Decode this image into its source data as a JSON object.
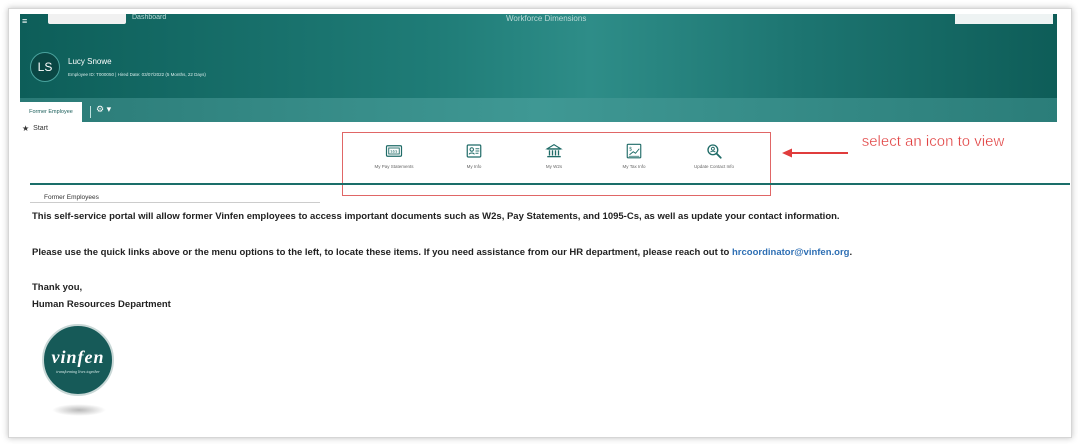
{
  "header": {
    "top_muted_text": "Dashboard",
    "app_title": "Workforce Dimensions",
    "user_initials": "LS",
    "user_name": "Lucy Snowe",
    "user_meta": "Employee ID: T000050  |  Hired Date: 03/07/2022 (5 Months, 22 Days)"
  },
  "tabs": {
    "active_label": "Former Employee",
    "gear_icon": "gear-icon"
  },
  "start_label": "Start",
  "quick_links": [
    {
      "label": "My Pay Statements",
      "icon": "pay-statement-icon"
    },
    {
      "label": "My Info",
      "icon": "id-card-icon"
    },
    {
      "label": "My W2s",
      "icon": "bank-icon"
    },
    {
      "label": "My Tax Info",
      "icon": "tax-document-icon"
    },
    {
      "label": "Update Contact Info",
      "icon": "magnifier-icon"
    }
  ],
  "annotation": {
    "text": "select an icon to view",
    "color": "#e03c3c"
  },
  "content": {
    "section_title": "Former Employees",
    "paragraph1": "This self-service portal will allow former Vinfen employees to access important documents such as W2s, Pay Statements, and 1095-Cs, as well as update your contact information.",
    "paragraph2_prefix": "Please use the quick links above or the menu options to the left, to locate these items. If you need assistance from our HR department, please reach out to ",
    "paragraph2_email": "hrcoordinator@vinfen.org",
    "paragraph2_suffix": ".",
    "closing": "Thank you,",
    "signature": "Human Resources Department"
  },
  "logo": {
    "word": "vinfen",
    "tagline": "transforming lives together"
  },
  "colors": {
    "brand_teal": "#165a58",
    "link_blue": "#2e6fb4",
    "annotation_red": "#e03c3c"
  }
}
